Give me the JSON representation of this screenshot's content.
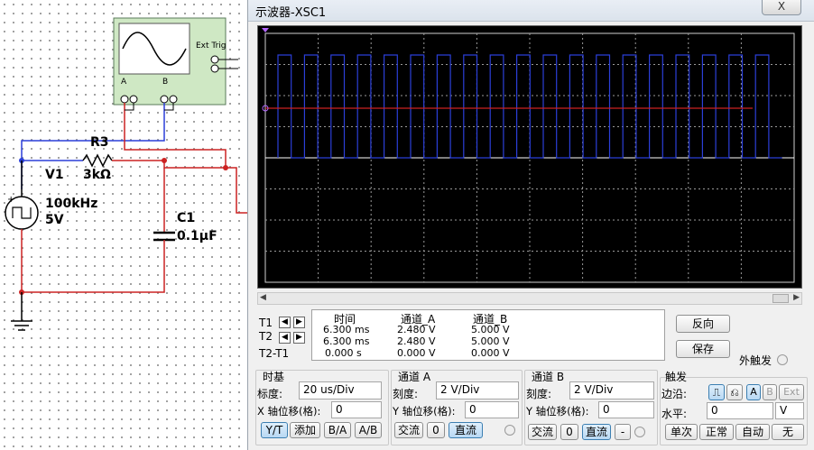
{
  "schematic": {
    "r3_label": "R3",
    "r3_value": "3kΩ",
    "v1_label": "V1",
    "v1_freq": "100kHz",
    "v1_amp": "5V",
    "c1_label": "C1",
    "c1_value": "0.1μF",
    "scope_ext_trig": "Ext Trig",
    "scope_a": "A",
    "scope_b": "B"
  },
  "window": {
    "title": "示波器-XSC1",
    "close": "X"
  },
  "readout": {
    "t1": "T1",
    "t2": "T2",
    "t2t1": "T2-T1",
    "headers": [
      "时间",
      "通道_A",
      "通道_B"
    ],
    "rows": [
      [
        "6.300 ms",
        "2.480 V",
        "5.000 V"
      ],
      [
        "6.300 ms",
        "2.480 V",
        "5.000 V"
      ],
      [
        "0.000 s",
        "0.000 V",
        "0.000 V"
      ]
    ],
    "reverse": "反向",
    "save": "保存",
    "ext_trigger": "外触发"
  },
  "timebase": {
    "title": "时基",
    "scale_label": "标度:",
    "scale_value": "20 us/Div",
    "xpos_label": "X 轴位移(格):",
    "xpos_value": "0",
    "btn_yt": "Y/T",
    "btn_add": "添加",
    "btn_ba": "B/A",
    "btn_ab": "A/B"
  },
  "channel_a": {
    "title": "通道 A",
    "scale_label": "刻度:",
    "scale_value": "2  V/Div",
    "ypos_label": "Y 轴位移(格):",
    "ypos_value": "0",
    "btn_ac": "交流",
    "btn_zero": "0",
    "btn_dc": "直流"
  },
  "channel_b": {
    "title": "通道 B",
    "scale_label": "刻度:",
    "scale_value": "2  V/Div",
    "ypos_label": "Y 轴位移(格):",
    "ypos_value": "0",
    "btn_ac": "交流",
    "btn_zero": "0",
    "btn_dc": "直流",
    "btn_minus": "-"
  },
  "trigger": {
    "title": "触发",
    "edge_label": "边沿:",
    "btn_a": "A",
    "btn_b": "B",
    "btn_ext": "Ext",
    "level_label": "水平:",
    "level_value": "0",
    "level_unit": "V",
    "btn_single": "单次",
    "btn_normal": "正常",
    "btn_auto": "自动",
    "btn_none": "无"
  },
  "colors": {
    "channel_a": "#cc2222",
    "channel_b": "#2b3fd8",
    "screen_bg": "#000000"
  }
}
